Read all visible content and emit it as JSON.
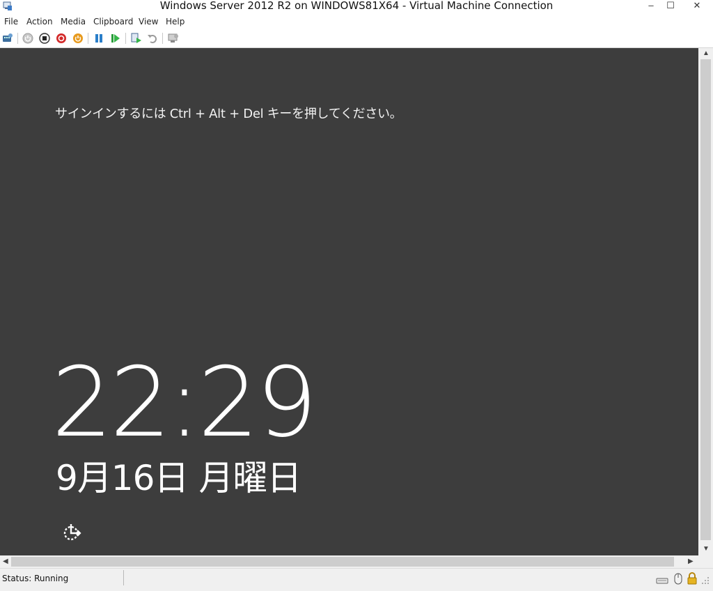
{
  "window": {
    "title": "Windows Server 2012 R2 on WINDOWS81X64 - Virtual Machine Connection",
    "controls": {
      "minimize": "–",
      "maximize": "☐",
      "close": "✕"
    }
  },
  "menu": {
    "items": [
      "File",
      "Action",
      "Media",
      "Clipboard",
      "View",
      "Help"
    ]
  },
  "toolbar": {
    "buttons": [
      "ctrl-alt-del-icon",
      "start-icon",
      "turn-off-icon",
      "shutdown-icon",
      "power-icon",
      "pause-icon",
      "resume-icon",
      "checkpoint-icon",
      "revert-icon",
      "enhanced-session-icon"
    ]
  },
  "vm_screen": {
    "signin_prompt": "サインインするには Ctrl + Alt + Del キーを押してください。",
    "time": "22:29",
    "date": "9月16日 月曜日",
    "ease_of_access_icon": "ease-of-access-icon"
  },
  "status": {
    "text": "Status: Running",
    "icons": [
      "keyboard-icon",
      "mouse-icon",
      "lock-icon"
    ]
  },
  "colors": {
    "console_bg": "#3d3d3d",
    "chrome_bg": "#f0f0f0"
  }
}
